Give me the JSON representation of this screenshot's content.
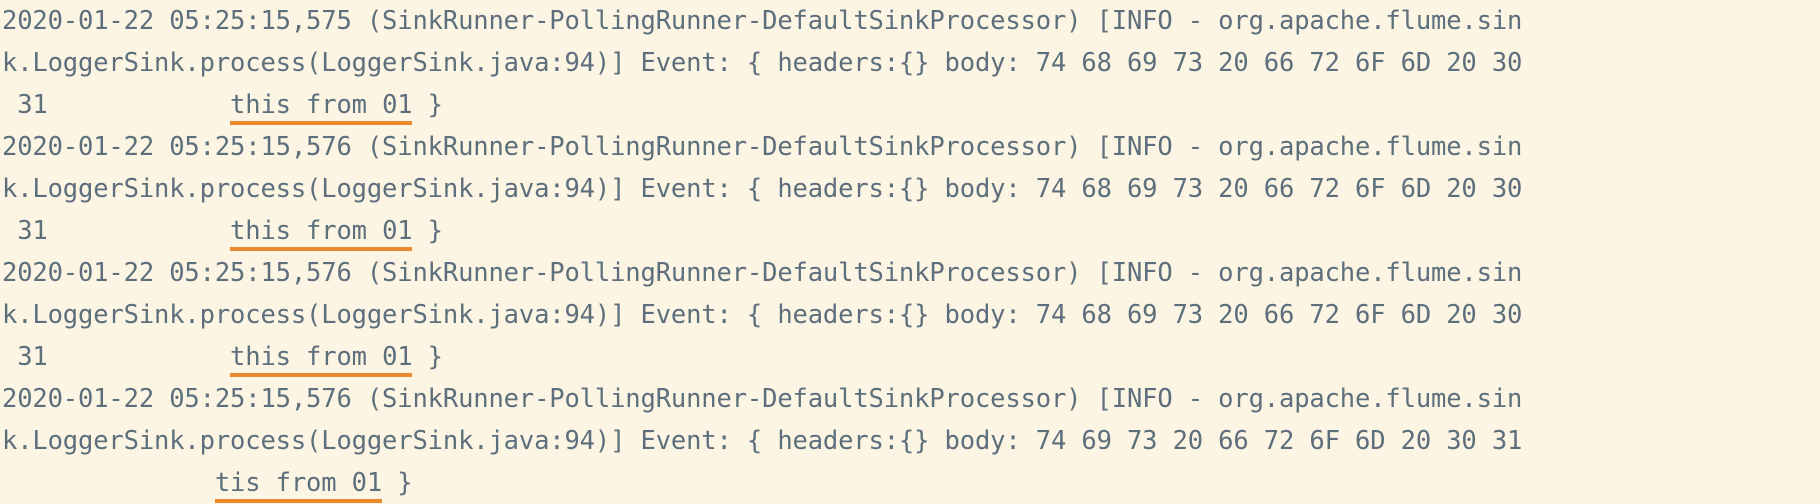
{
  "console": {
    "name": "flume-logger-sink-console",
    "background_color": "#FDF5E3",
    "text_color": "#5D6F7C",
    "highlight_underline_color": "#EC8B2E",
    "font": "monospace",
    "entries": [
      {
        "id": "entry-1",
        "timestamp": "2020-01-22 05:25:15,575",
        "thread": "(SinkRunner-PollingRunner-DefaultSinkProcessor)",
        "level": "INFO",
        "logger": "org.apache.flume.sink.LoggerSink.process(LoggerSink.java:94)",
        "line1": "2020-01-22 05:25:15,575 (SinkRunner-PollingRunner-DefaultSinkProcessor) [INFO - org.apache.flume.sin",
        "line2": "k.LoggerSink.process(LoggerSink.java:94)] Event: { headers:{} body: 74 68 69 73 20 66 72 6F 6D 20 30",
        "line3_prefix": " 31            ",
        "line3_highlight": "this from 01",
        "line3_suffix": " }",
        "body_hex": "74 68 69 73 20 66 72 6F 6D 20 30 31",
        "body_decoded": "this from 01"
      },
      {
        "id": "entry-2",
        "timestamp": "2020-01-22 05:25:15,576",
        "thread": "(SinkRunner-PollingRunner-DefaultSinkProcessor)",
        "level": "INFO",
        "logger": "org.apache.flume.sink.LoggerSink.process(LoggerSink.java:94)",
        "line1": "2020-01-22 05:25:15,576 (SinkRunner-PollingRunner-DefaultSinkProcessor) [INFO - org.apache.flume.sin",
        "line2": "k.LoggerSink.process(LoggerSink.java:94)] Event: { headers:{} body: 74 68 69 73 20 66 72 6F 6D 20 30",
        "line3_prefix": " 31            ",
        "line3_highlight": "this from 01",
        "line3_suffix": " }",
        "body_hex": "74 68 69 73 20 66 72 6F 6D 20 30 31",
        "body_decoded": "this from 01"
      },
      {
        "id": "entry-3",
        "timestamp": "2020-01-22 05:25:15,576",
        "thread": "(SinkRunner-PollingRunner-DefaultSinkProcessor)",
        "level": "INFO",
        "logger": "org.apache.flume.sink.LoggerSink.process(LoggerSink.java:94)",
        "line1": "2020-01-22 05:25:15,576 (SinkRunner-PollingRunner-DefaultSinkProcessor) [INFO - org.apache.flume.sin",
        "line2": "k.LoggerSink.process(LoggerSink.java:94)] Event: { headers:{} body: 74 68 69 73 20 66 72 6F 6D 20 30",
        "line3_prefix": " 31            ",
        "line3_highlight": "this from 01",
        "line3_suffix": " }",
        "body_hex": "74 68 69 73 20 66 72 6F 6D 20 30 31",
        "body_decoded": "this from 01"
      },
      {
        "id": "entry-4",
        "timestamp": "2020-01-22 05:25:15,576",
        "thread": "(SinkRunner-PollingRunner-DefaultSinkProcessor)",
        "level": "INFO",
        "logger": "org.apache.flume.sink.LoggerSink.process(LoggerSink.java:94)",
        "line1": "2020-01-22 05:25:15,576 (SinkRunner-PollingRunner-DefaultSinkProcessor) [INFO - org.apache.flume.sin",
        "line2": "k.LoggerSink.process(LoggerSink.java:94)] Event: { headers:{} body: 74 69 73 20 66 72 6F 6D 20 30 31",
        "line3_prefix": "              ",
        "line3_highlight": "tis from 01",
        "line3_suffix": " }",
        "body_hex": "74 69 73 20 66 72 6F 6D 20 30 31",
        "body_decoded": "tis from 01"
      }
    ]
  }
}
